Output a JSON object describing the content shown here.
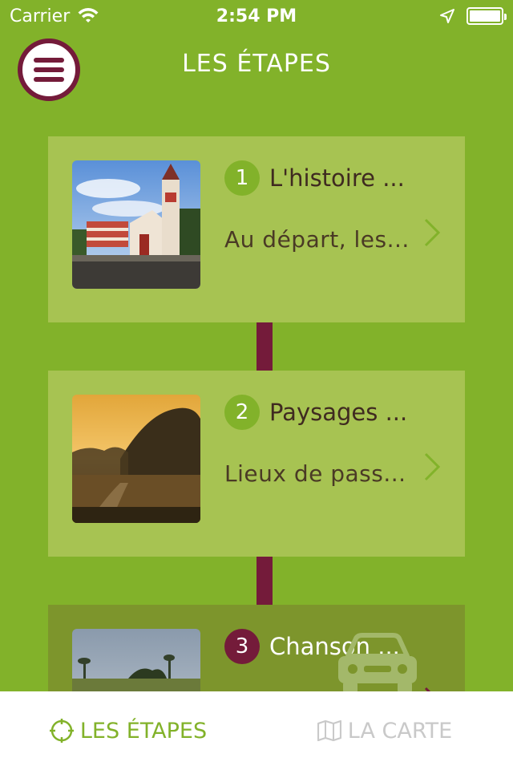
{
  "status_bar": {
    "carrier": "Carrier",
    "time": "2:54 PM"
  },
  "header": {
    "title": "LES ÉTAPES",
    "menu_icon": "hamburger-icon"
  },
  "colors": {
    "background": "#82b22a",
    "card": "#a7c352",
    "card_active": "#7d952c",
    "accent": "#741b3a",
    "tab_active": "#82b22a",
    "tab_inactive": "#c9c9c9"
  },
  "stages": [
    {
      "number": "1",
      "title": "L'histoire ...",
      "subtitle": "Au départ, les..."
    },
    {
      "number": "2",
      "title": "Paysages ...",
      "subtitle": "Lieux de pass..."
    },
    {
      "number": "3",
      "title": "Chanson ...",
      "subtitle": ""
    }
  ],
  "tab_bar": {
    "tabs": [
      {
        "label": "LES ÉTAPES",
        "icon": "crosshair-icon",
        "active": true
      },
      {
        "label": "LA CARTE",
        "icon": "map-icon",
        "active": false
      }
    ]
  }
}
